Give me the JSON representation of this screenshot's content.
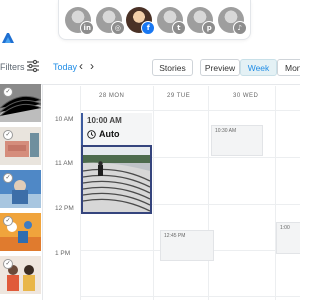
{
  "profiles": [
    {
      "name": "profile-linkedin",
      "badge": "in",
      "active": false
    },
    {
      "name": "profile-instagram",
      "badge": "◎",
      "active": false
    },
    {
      "name": "profile-facebook",
      "badge": "f",
      "active": true
    },
    {
      "name": "profile-twitter",
      "badge": "t",
      "active": false
    },
    {
      "name": "profile-pinterest",
      "badge": "p",
      "active": false
    },
    {
      "name": "profile-tiktok",
      "badge": "♪",
      "active": false
    }
  ],
  "toolbar": {
    "filters_label": "Filters",
    "today_label": "Today",
    "prev_symbol": "‹",
    "next_symbol": "›",
    "stories_label": "Stories",
    "preview_label": "Preview",
    "week_label": "Week",
    "month_label": "Mon"
  },
  "calendar": {
    "days": [
      "28 MON",
      "29 TUE",
      "30 WED"
    ],
    "hours": [
      "10 AM",
      "11 AM",
      "12 PM",
      "1 PM"
    ],
    "post": {
      "time": "10:00 AM",
      "mode": "Auto"
    },
    "slots": [
      "10:30 AM",
      "12:45 PM",
      "1:00"
    ]
  },
  "colors": {
    "accent": "#1f8ce6",
    "selected_border": "#35447d",
    "active_view_bg": "#e4f1f5"
  }
}
